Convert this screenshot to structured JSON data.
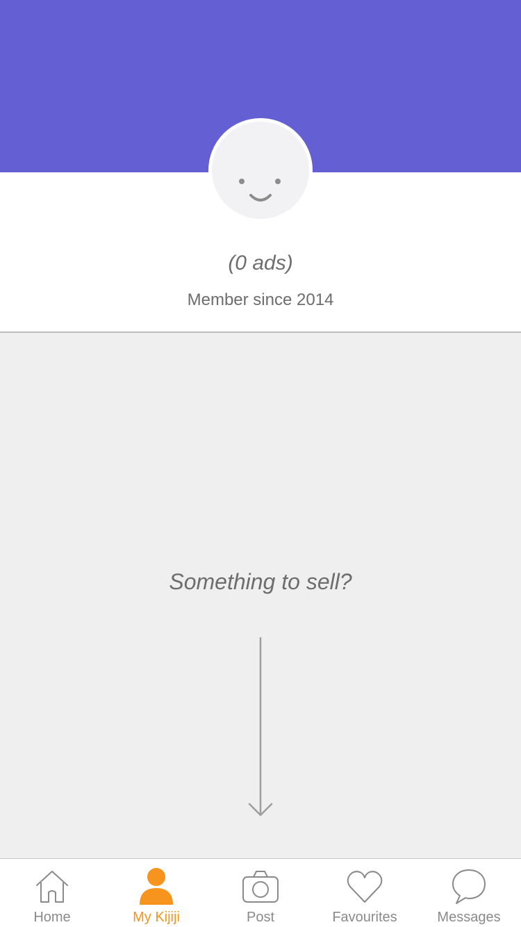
{
  "profile": {
    "ads_count": "(0 ads)",
    "member_since": "Member since 2014",
    "avatar_icon": "smiley-face-icon"
  },
  "main": {
    "sell_prompt": "Something to sell?",
    "arrow_icon": "arrow-down-icon"
  },
  "tab_bar": {
    "tabs": [
      {
        "label": "Home",
        "icon": "home-icon",
        "active": false
      },
      {
        "label": "My Kijiji",
        "icon": "person-icon",
        "active": true
      },
      {
        "label": "Post",
        "icon": "camera-icon",
        "active": false
      },
      {
        "label": "Favourites",
        "icon": "heart-icon",
        "active": false
      },
      {
        "label": "Messages",
        "icon": "chat-bubble-icon",
        "active": false
      }
    ]
  },
  "colors": {
    "header_banner": "#6460d4",
    "active_tab": "#f7941d",
    "inactive_tab": "#8a8a8a",
    "main_background": "#efefef"
  }
}
